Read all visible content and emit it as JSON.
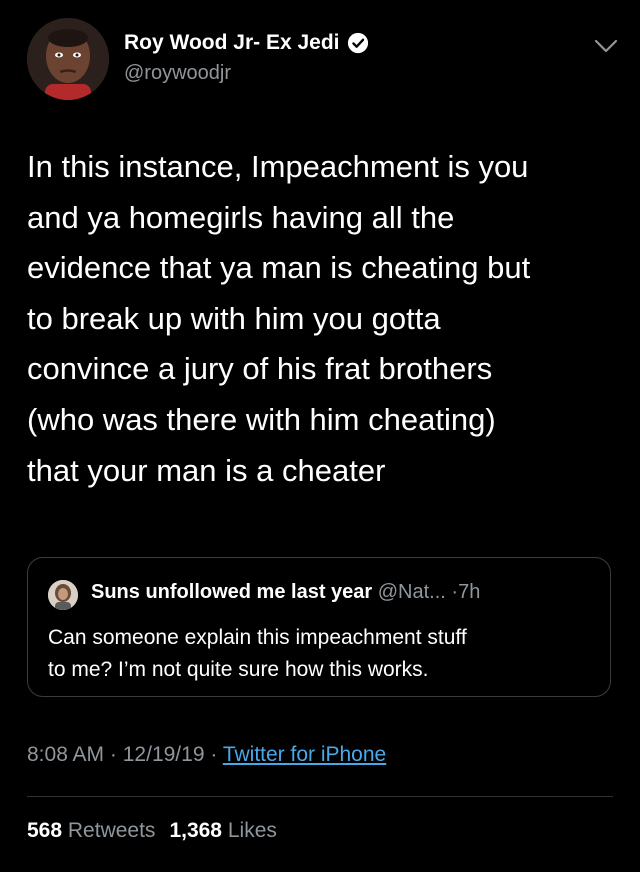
{
  "tweet": {
    "author_name": "Roy Wood Jr- Ex Jedi",
    "author_handle": "@roywoodjr",
    "text_lines": [
      "In this instance, Impeachment is you",
      "and ya homegirls having all the",
      "evidence that ya man is cheating but",
      "to break up with him you gotta",
      "convince a jury of his frat brothers",
      "(who was there with him cheating)",
      "that your man is a cheater"
    ],
    "time": "8:08 AM",
    "date": "12/19/19",
    "separator": "·",
    "source": "Twitter for iPhone",
    "retweets_count": "568",
    "retweets_label": "Retweets",
    "likes_count": "1,368",
    "likes_label": "Likes"
  },
  "quoted": {
    "author_name": "Suns unfollowed me last year",
    "author_handle": "@Nat...",
    "separator": "·",
    "time": "7h",
    "text_lines": [
      "Can someone explain this impeachment stuff",
      "to me? I’m not quite sure how this works."
    ]
  },
  "icons": {
    "verified": "verified-badge-icon",
    "more": "chevron-down-icon"
  },
  "colors": {
    "background": "#000000",
    "text": "#ffffff",
    "secondary": "#8f969c",
    "link": "#4aa8e8",
    "border": "#3a3d40"
  }
}
